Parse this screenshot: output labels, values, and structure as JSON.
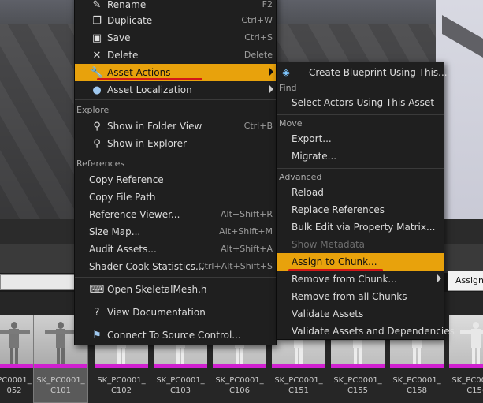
{
  "context_menu": {
    "top_items": [
      {
        "id": "rename",
        "label": "Rename",
        "shortcut": "F2",
        "icon": "rename-icon"
      },
      {
        "id": "duplicate",
        "label": "Duplicate",
        "shortcut": "Ctrl+W",
        "icon": "duplicate-icon"
      },
      {
        "id": "save",
        "label": "Save",
        "shortcut": "Ctrl+S",
        "icon": "save-icon"
      },
      {
        "id": "delete",
        "label": "Delete",
        "shortcut": "Delete",
        "icon": "delete-icon"
      },
      {
        "id": "asset-actions",
        "label": "Asset Actions",
        "icon": "wrench-icon"
      },
      {
        "id": "asset-localization",
        "label": "Asset Localization",
        "icon": "globe-icon"
      }
    ],
    "explore_header": "Explore",
    "explore_items": [
      {
        "id": "show-in-folder-view",
        "label": "Show in Folder View",
        "shortcut": "Ctrl+B",
        "icon": "magnifier-icon"
      },
      {
        "id": "show-in-explorer",
        "label": "Show in Explorer",
        "icon": "magnifier-icon"
      }
    ],
    "references_header": "References",
    "references_items": [
      {
        "id": "copy-reference",
        "label": "Copy Reference"
      },
      {
        "id": "copy-file-path",
        "label": "Copy File Path"
      },
      {
        "id": "reference-viewer",
        "label": "Reference Viewer...",
        "shortcut": "Alt+Shift+R"
      },
      {
        "id": "size-map",
        "label": "Size Map...",
        "shortcut": "Alt+Shift+M"
      },
      {
        "id": "audit-assets",
        "label": "Audit Assets...",
        "shortcut": "Alt+Shift+A"
      },
      {
        "id": "shader-cook-statistics",
        "label": "Shader Cook Statistics...",
        "shortcut": "Ctrl+Alt+Shift+S"
      }
    ],
    "bottom_items": [
      {
        "id": "open-skeletal-mesh-h",
        "label": "Open SkeletalMesh.h",
        "icon": "code-file-icon"
      },
      {
        "id": "view-documentation",
        "label": "View Documentation",
        "icon": "help-icon"
      },
      {
        "id": "connect-source-control",
        "label": "Connect To Source Control...",
        "icon": "source-control-icon"
      }
    ]
  },
  "asset_actions_menu": {
    "create_blueprint": {
      "label": "Create Blueprint Using This...",
      "icon": "blueprint-icon"
    },
    "find_header": "Find",
    "select_actors": "Select Actors Using This Asset",
    "move_header": "Move",
    "export": "Export...",
    "migrate": "Migrate...",
    "advanced_header": "Advanced",
    "reload": "Reload",
    "replace_references": "Replace References",
    "bulk_edit": "Bulk Edit via Property Matrix...",
    "show_metadata": "Show Metadata",
    "assign_to_chunk": "Assign to Chunk...",
    "remove_from_chunk": "Remove from Chunk...",
    "remove_from_all_chunks": "Remove from all Chunks",
    "validate_assets": "Validate Assets",
    "validate_assets_deps": "Validate Assets and Dependencies"
  },
  "tooltip": {
    "text": "Assign"
  },
  "assets": [
    {
      "line1": "PC0001_",
      "line2": "052"
    },
    {
      "line1": "SK_PC0001_",
      "line2": "C101"
    },
    {
      "line1": "SK_PC0001_",
      "line2": "C102"
    },
    {
      "line1": "SK_PC0001_",
      "line2": "C103"
    },
    {
      "line1": "SK_PC0001_",
      "line2": "C106"
    },
    {
      "line1": "SK_PC0001_",
      "line2": "C151"
    },
    {
      "line1": "SK_PC0001_",
      "line2": "C155"
    },
    {
      "line1": "SK_PC0001_",
      "line2": "C158"
    },
    {
      "line1": "SK_PC0001_",
      "line2": "C15("
    }
  ],
  "colors": {
    "highlight": "#e8a20c",
    "underline": "#d31717",
    "asset_bar": "#d020d0"
  }
}
